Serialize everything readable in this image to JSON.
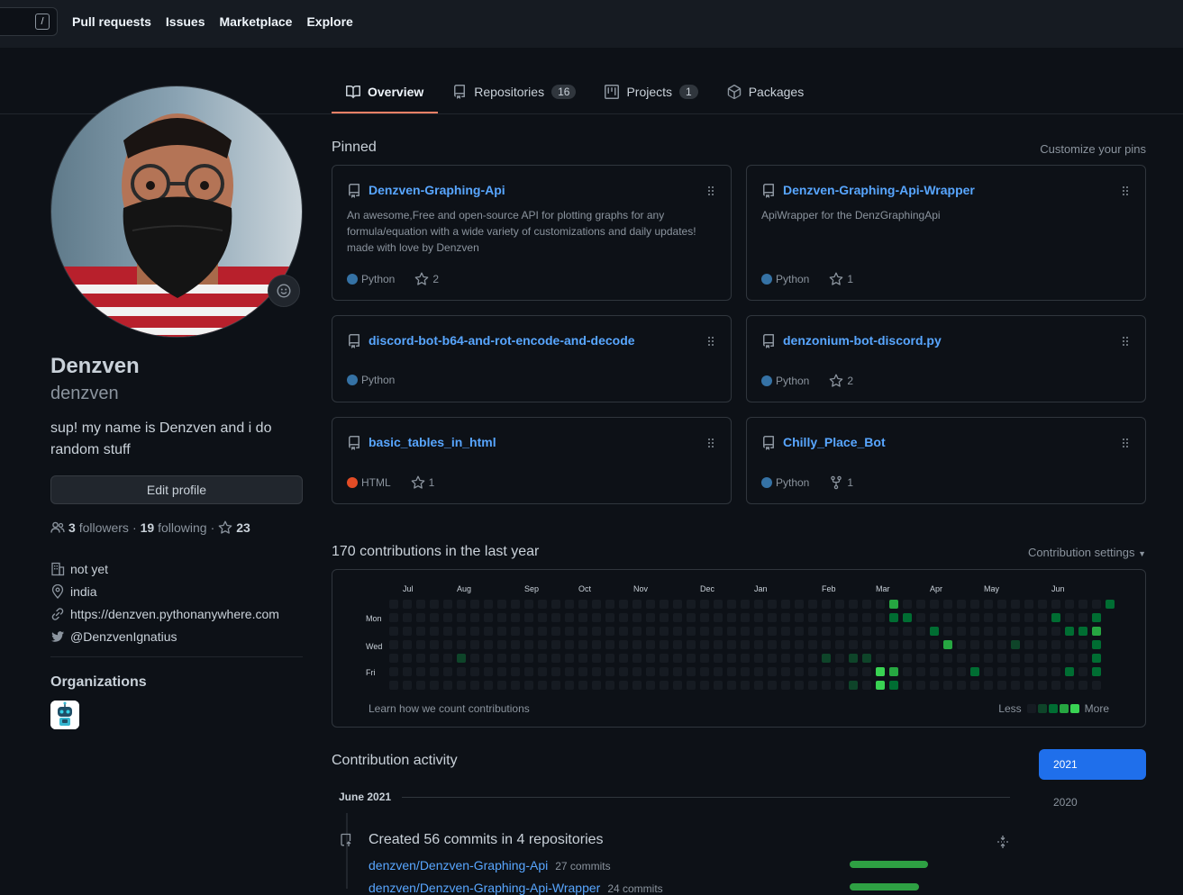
{
  "header": {
    "search_key": "/",
    "nav": [
      "Pull requests",
      "Issues",
      "Marketplace",
      "Explore"
    ]
  },
  "tabs": [
    {
      "label": "Overview",
      "icon": "book-icon",
      "active": true
    },
    {
      "label": "Repositories",
      "icon": "repo-icon",
      "count": "16"
    },
    {
      "label": "Projects",
      "icon": "project-icon",
      "count": "1"
    },
    {
      "label": "Packages",
      "icon": "package-icon"
    }
  ],
  "profile": {
    "name": "Denzven",
    "login": "denzven",
    "bio": "sup! my name is Denzven and i do random stuff",
    "edit_label": "Edit profile",
    "followers_count": "3",
    "followers_label": "followers",
    "following_count": "19",
    "following_label": "following",
    "stars_count": "23",
    "company": "not yet",
    "location": "india",
    "website": "https://denzven.pythonanywhere.com",
    "twitter": "@DenzvenIgnatius",
    "organizations_title": "Organizations"
  },
  "pinned": {
    "title": "Pinned",
    "customize": "Customize your pins",
    "repos": [
      {
        "name": "Denzven-Graphing-Api",
        "desc": "An awesome,Free and open-source API for plotting graphs for any formula/equation with a wide variety of customizations and daily updates! made with love by Denzven",
        "lang": "Python",
        "lang_color": "#3572A5",
        "stat_icon": "star-icon",
        "stat": "2"
      },
      {
        "name": "Denzven-Graphing-Api-Wrapper",
        "desc": "ApiWrapper for the DenzGraphingApi",
        "lang": "Python",
        "lang_color": "#3572A5",
        "stat_icon": "star-icon",
        "stat": "1"
      },
      {
        "name": "discord-bot-b64-and-rot-encode-and-decode",
        "desc": "",
        "lang": "Python",
        "lang_color": "#3572A5",
        "stat_icon": "",
        "stat": ""
      },
      {
        "name": "denzonium-bot-discord.py",
        "desc": "",
        "lang": "Python",
        "lang_color": "#3572A5",
        "stat_icon": "star-icon",
        "stat": "2"
      },
      {
        "name": "basic_tables_in_html",
        "desc": "",
        "lang": "HTML",
        "lang_color": "#e34c26",
        "stat_icon": "star-icon",
        "stat": "1"
      },
      {
        "name": "Chilly_Place_Bot",
        "desc": "",
        "lang": "Python",
        "lang_color": "#3572A5",
        "stat_icon": "fork-icon",
        "stat": "1"
      }
    ]
  },
  "contributions": {
    "title": "170 contributions in the last year",
    "settings": "Contribution settings",
    "months": [
      "Jul",
      "Aug",
      "Sep",
      "Oct",
      "Nov",
      "Dec",
      "Jan",
      "Feb",
      "Mar",
      "Apr",
      "May",
      "Jun"
    ],
    "days": [
      "Mon",
      "Wed",
      "Fri"
    ],
    "learn": "Learn how we count contributions",
    "less": "Less",
    "more": "More",
    "level_colors": [
      "#161b22",
      "#0e4429",
      "#006d32",
      "#26a641",
      "#39d353"
    ],
    "active_cells": [
      [
        5,
        4,
        1
      ],
      [
        32,
        4,
        1
      ],
      [
        34,
        4,
        1
      ],
      [
        34,
        6,
        1
      ],
      [
        35,
        4,
        1
      ],
      [
        36,
        5,
        4
      ],
      [
        36,
        6,
        4
      ],
      [
        36,
        7,
        3
      ],
      [
        37,
        0,
        3
      ],
      [
        37,
        1,
        2
      ],
      [
        37,
        5,
        3
      ],
      [
        37,
        6,
        2
      ],
      [
        37,
        7,
        1
      ],
      [
        38,
        1,
        2
      ],
      [
        40,
        2,
        2
      ],
      [
        41,
        3,
        3
      ],
      [
        43,
        5,
        2
      ],
      [
        46,
        3,
        1
      ],
      [
        49,
        1,
        2
      ],
      [
        50,
        2,
        2
      ],
      [
        50,
        5,
        2
      ],
      [
        51,
        2,
        2
      ],
      [
        52,
        1,
        1
      ],
      [
        52,
        4,
        2
      ],
      [
        53,
        4,
        3
      ],
      [
        53,
        5,
        3
      ],
      [
        53,
        6,
        2
      ],
      [
        54,
        1,
        2
      ],
      [
        54,
        2,
        3
      ],
      [
        54,
        3,
        2
      ],
      [
        54,
        5,
        2
      ],
      [
        55,
        0,
        2
      ]
    ]
  },
  "activity": {
    "title": "Contribution activity",
    "year_selected": "2021",
    "year_other": "2020",
    "month": "June 2021",
    "summary": "Created 56 commits in 4 repositories",
    "repos": [
      {
        "name": "denzven/Denzven-Graphing-Api",
        "commits": "27 commits",
        "share": 27
      },
      {
        "name": "denzven/Denzven-Graphing-Api-Wrapper",
        "commits": "24 commits",
        "share": 24
      }
    ]
  }
}
